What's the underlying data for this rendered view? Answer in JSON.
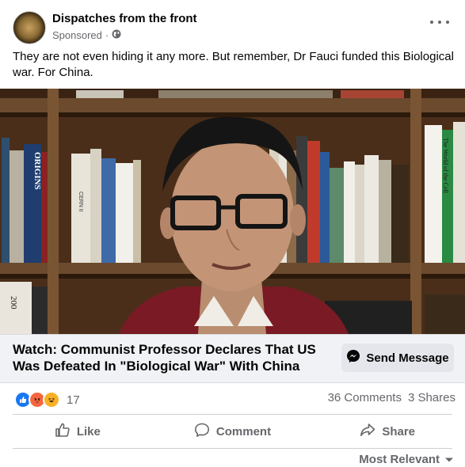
{
  "post": {
    "page_name": "Dispatches from the front",
    "meta_label": "Sponsored",
    "meta_sep": "·",
    "text": "They are not even hiding it any  more. But remember, Dr Fauci funded this Biological war. For China."
  },
  "video": {
    "book_titles": [
      "ORIGINS",
      "CERN II",
      "The World of the Cell",
      "200"
    ]
  },
  "link": {
    "title": "Watch: Communist Professor Declares That US Was Defeated In \"Biological War\" With China",
    "send_label": "Send Message"
  },
  "stats": {
    "reaction_count": "17",
    "comments": "36 Comments",
    "shares": "3 Shares"
  },
  "actions": {
    "like": "Like",
    "comment": "Comment",
    "share": "Share"
  },
  "comments_sort": "Most Relevant",
  "colors": {
    "accent": "#1877f2",
    "muted_text": "#65676b",
    "link_bar_bg": "#f0f2f5"
  },
  "icons": [
    "globe-icon",
    "more-options-icon",
    "messenger-icon",
    "like-reaction-icon",
    "angry-reaction-icon",
    "haha-reaction-icon",
    "thumbs-up-icon",
    "comment-icon",
    "share-icon",
    "caret-down-icon"
  ]
}
